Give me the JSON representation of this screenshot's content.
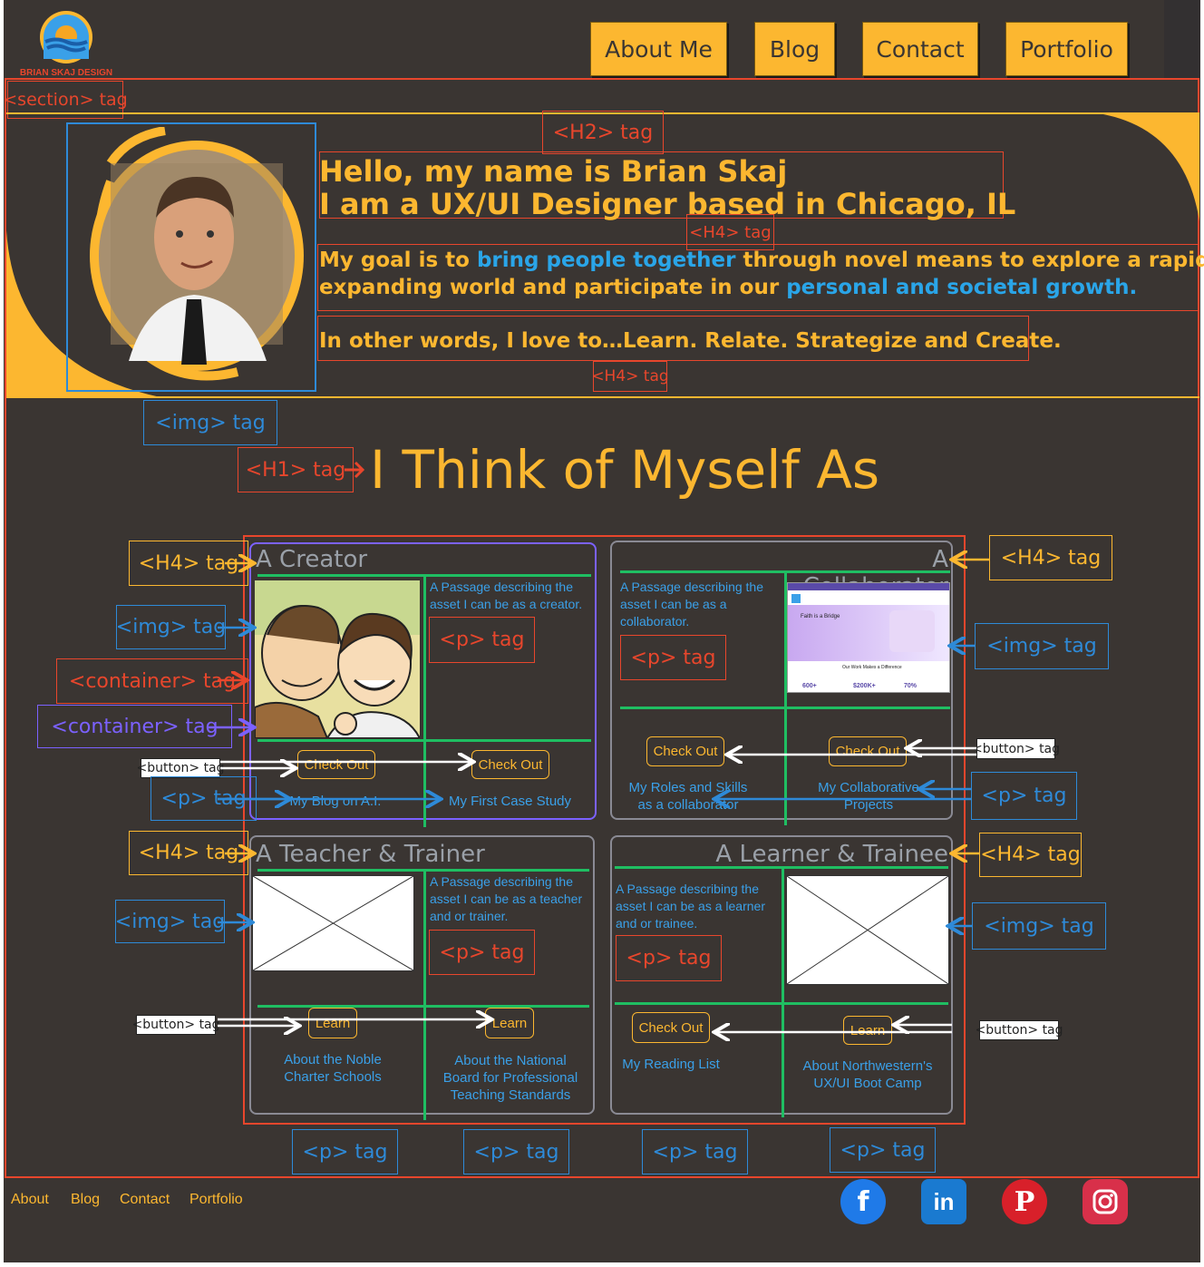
{
  "header": {
    "logo_text": "BRIAN SKAJ DESIGN",
    "nav": [
      "About Me",
      "Blog",
      "Contact",
      "Portfolio"
    ]
  },
  "hero": {
    "heading_line1": "Hello, my name is Brian Skaj",
    "heading_line2": "I am a UX/UI Designer based in Chicago, IL",
    "goal_part1": "My goal is to ",
    "goal_highlight1": "bring people together",
    "goal_part2": " through novel means to explore a rapidly",
    "goal_part3": "expanding world and participate in our ",
    "goal_highlight2": "personal and societal growth.",
    "tagline": "In other words, I love to…Learn. Relate. Strategize and Create."
  },
  "main_heading": "I Think of Myself As",
  "cards": {
    "creator": {
      "title": "A Creator",
      "passage": "A Passage describing the asset I can be as a creator.",
      "button_left": "Check Out",
      "button_right": "Check Out",
      "link_left": "My Blog on A.I.",
      "link_right": "My First Case Study"
    },
    "collaborator": {
      "title": "A Collaborator",
      "passage": "A Passage describing the asset I can be as a collaborator.",
      "button_left": "Check Out",
      "button_right": "Check Out",
      "link_left": "My Roles and Skills as a collaborator",
      "link_right": "My Collaborative Projects",
      "screenshot_title": "Faith is a Bridge",
      "screenshot_subheading": "Our Work Makes a Difference",
      "stats": [
        "600+",
        "$200K+",
        "70%"
      ]
    },
    "teacher": {
      "title": "A Teacher & Trainer",
      "passage": "A Passage describing the asset I can be as a teacher and or trainer.",
      "button_left": "Learn",
      "button_right": "Learn",
      "link_left": "About the Noble Charter Schools",
      "link_right": "About the National Board for Professional Teaching Standards"
    },
    "learner": {
      "title": "A Learner & Trainee",
      "passage": "A Passage describing the asset I can be as a learner and or trainee.",
      "button_left": "Check Out",
      "button_right": "Learn",
      "link_left": "My Reading List",
      "link_right": "About Northwestern's UX/UI Boot Camp"
    }
  },
  "annotations": {
    "section": "<section> tag",
    "h2": "<H2> tag",
    "h4": "<H4> tag",
    "img": "<img> tag",
    "h1": "<H1> tag",
    "container": "<container> tag",
    "button": "<button> tag",
    "p": "<p> tag"
  },
  "footer": {
    "links": [
      "About",
      "Blog",
      "Contact",
      "Portfolio"
    ],
    "social": [
      "facebook-icon",
      "linkedin-icon",
      "pinterest-icon",
      "instagram-icon"
    ]
  },
  "colors": {
    "background": "#3a3532",
    "accent": "#fcb730",
    "highlight": "#2aa5e8",
    "annotation_red": "#e8462c",
    "annotation_blue": "#2e8ad8",
    "annotation_purple": "#7b61ff",
    "divider_green": "#1fbe62"
  }
}
